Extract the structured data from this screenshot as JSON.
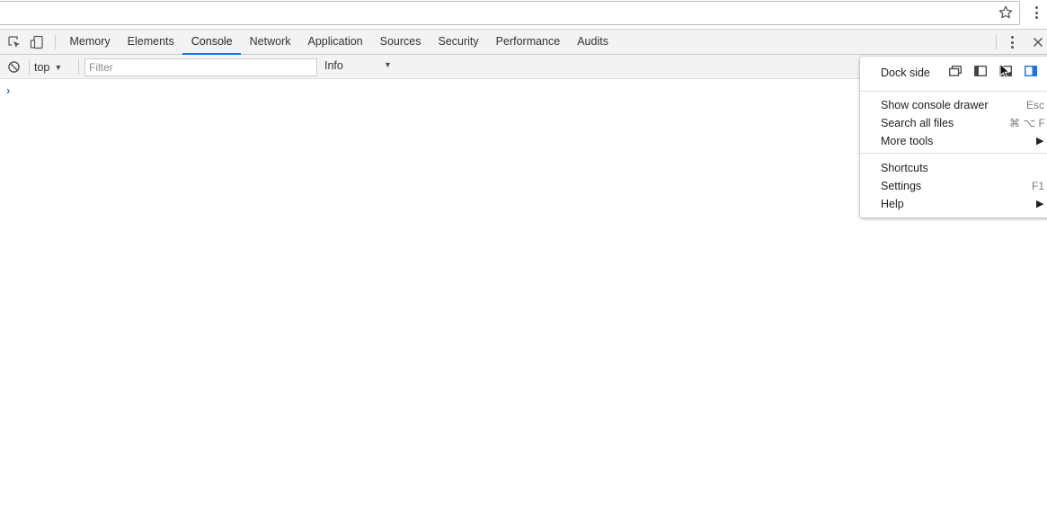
{
  "devtools": {
    "tabs": [
      {
        "label": "Memory"
      },
      {
        "label": "Elements"
      },
      {
        "label": "Console"
      },
      {
        "label": "Network"
      },
      {
        "label": "Application"
      },
      {
        "label": "Sources"
      },
      {
        "label": "Security"
      },
      {
        "label": "Performance"
      },
      {
        "label": "Audits"
      }
    ],
    "active_tab": "Console",
    "icons": {
      "inspect": "inspect-element-icon",
      "device": "device-toolbar-icon",
      "more": "more-vertical-icon",
      "close": "close-icon"
    }
  },
  "console_toolbar": {
    "context": "top",
    "filter_placeholder": "Filter",
    "level": "Info"
  },
  "console": {
    "prompt": "›"
  },
  "menu": {
    "dock_side_label": "Dock side",
    "dock_options": [
      "undock-icon",
      "dock-left-icon",
      "dock-bottom-icon",
      "dock-right-icon"
    ],
    "dock_selected": "dock-right-icon",
    "items": [
      {
        "label": "Show console drawer",
        "shortcut": "Esc"
      },
      {
        "label": "Search all files",
        "shortcut": "⌘ ⌥ F"
      },
      {
        "label": "More tools",
        "submenu": "▶"
      },
      {
        "label": "Shortcuts"
      },
      {
        "label": "Settings",
        "shortcut": "F1"
      },
      {
        "label": "Help",
        "submenu": "▶"
      }
    ]
  },
  "colors": {
    "accent": "#1a73e8",
    "toolbar_bg": "#f3f3f3"
  }
}
